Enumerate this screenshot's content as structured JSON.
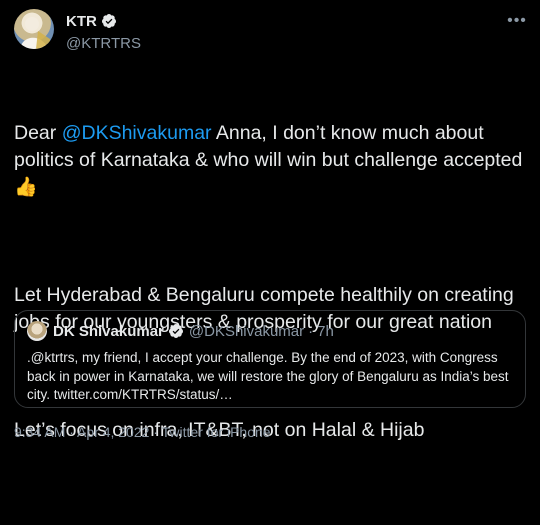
{
  "author": {
    "display_name": "KTR",
    "handle": "@KTRTRS"
  },
  "more_icon": "more-horizontal-icon",
  "tweet": {
    "p1_prefix": "Dear ",
    "p1_mention": "@DKShivakumar",
    "p1_rest": " Anna, I don’t know much about politics of Karnataka & who will win but challenge accepted",
    "p1_emoji": "👍",
    "p2": "Let Hyderabad & Bengaluru compete healthily on creating jobs for our youngsters & prosperity for our great nation",
    "p3": "Let’s focus on infra, IT&BT, not on Halal & Hijab"
  },
  "quoted": {
    "display_name": "DK Shivakumar",
    "handle": "@DKShivakumar",
    "separator": "·",
    "time_ago": "7h",
    "text": ".@ktrtrs, my friend, I accept your challenge. By the end of 2023, with Congress back in power in Karnataka, we will restore the glory of Bengaluru as India’s best city. twitter.com/KTRTRS/status/…"
  },
  "footer": {
    "timestamp": "9:34 AM · Apr 4, 2022",
    "separator": " · ",
    "source": "Twitter for iPhone"
  },
  "colors": {
    "background": "#000000",
    "text": "#e7e9ea",
    "secondary": "#8b98a5",
    "link": "#1d9bf0",
    "border": "#333639"
  }
}
